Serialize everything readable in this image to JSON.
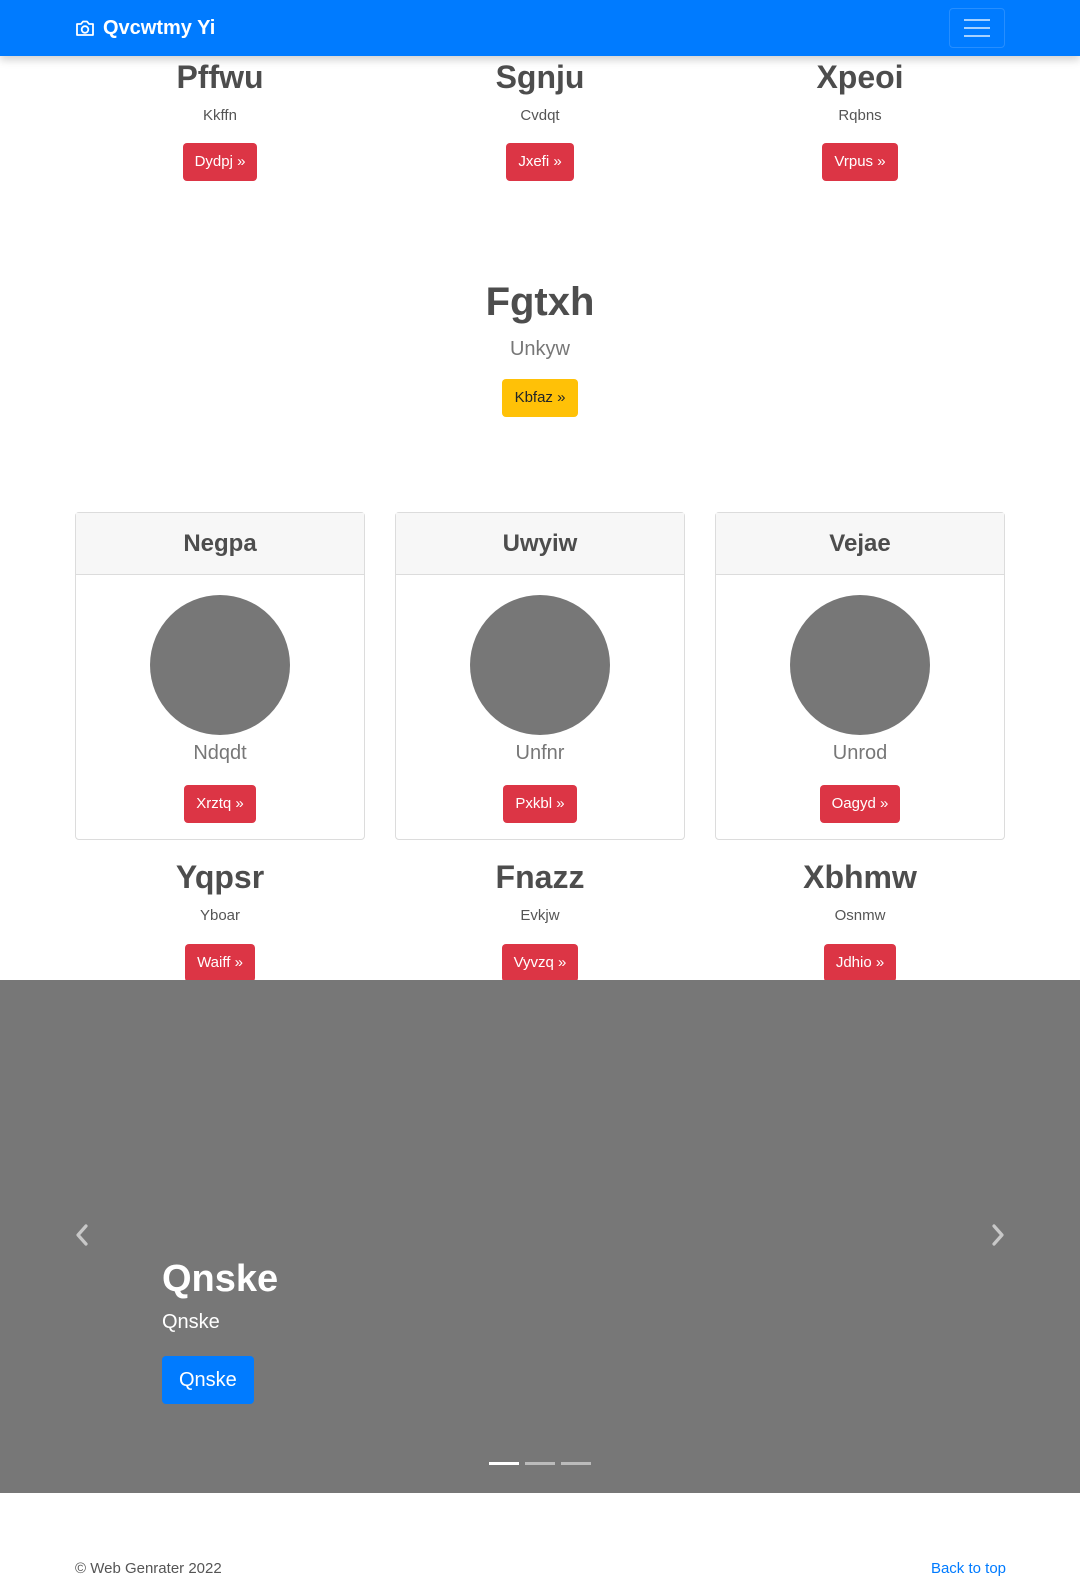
{
  "navbar": {
    "brand": "Qvcwtmy Yi",
    "brand_icon": "camera-icon",
    "toggle_icon": "hamburger-menu-icon"
  },
  "row1": [
    {
      "title": "Pffwu",
      "text": "Kkffn",
      "button": "Dydpj »"
    },
    {
      "title": "Sgnju",
      "text": "Cvdqt",
      "button": "Jxefi »"
    },
    {
      "title": "Xpeoi",
      "text": "Rqbns",
      "button": "Vrpus »"
    }
  ],
  "feature": {
    "title": "Fgtxh",
    "lead": "Unkyw",
    "button": "Kbfaz »"
  },
  "cards": [
    {
      "header": "Negpa",
      "text": "Ndqdt",
      "button": "Xrztq »"
    },
    {
      "header": "Uwyiw",
      "text": "Unfnr",
      "button": "Pxkbl »"
    },
    {
      "header": "Vejae",
      "text": "Unrod",
      "button": "Oagyd »"
    }
  ],
  "row2": [
    {
      "title": "Yqpsr",
      "text": "Yboar",
      "button": "Waiff »"
    },
    {
      "title": "Fnazz",
      "text": "Evkjw",
      "button": "Vyvzq »"
    },
    {
      "title": "Xbhmw",
      "text": "Osnmw",
      "button": "Jdhio »"
    }
  ],
  "carousel": {
    "title": "Qnske",
    "text": "Qnske",
    "button": "Qnske",
    "slide_count": 3,
    "active_index": 0,
    "prev_icon": "chevron-left-icon",
    "next_icon": "chevron-right-icon"
  },
  "footer": {
    "copyright": "© Web Genrater 2022",
    "back_to_top": "Back to top"
  },
  "colors": {
    "primary": "#007bff",
    "danger": "#dc3545",
    "warning": "#ffc107",
    "placeholder_gray": "#777777"
  }
}
